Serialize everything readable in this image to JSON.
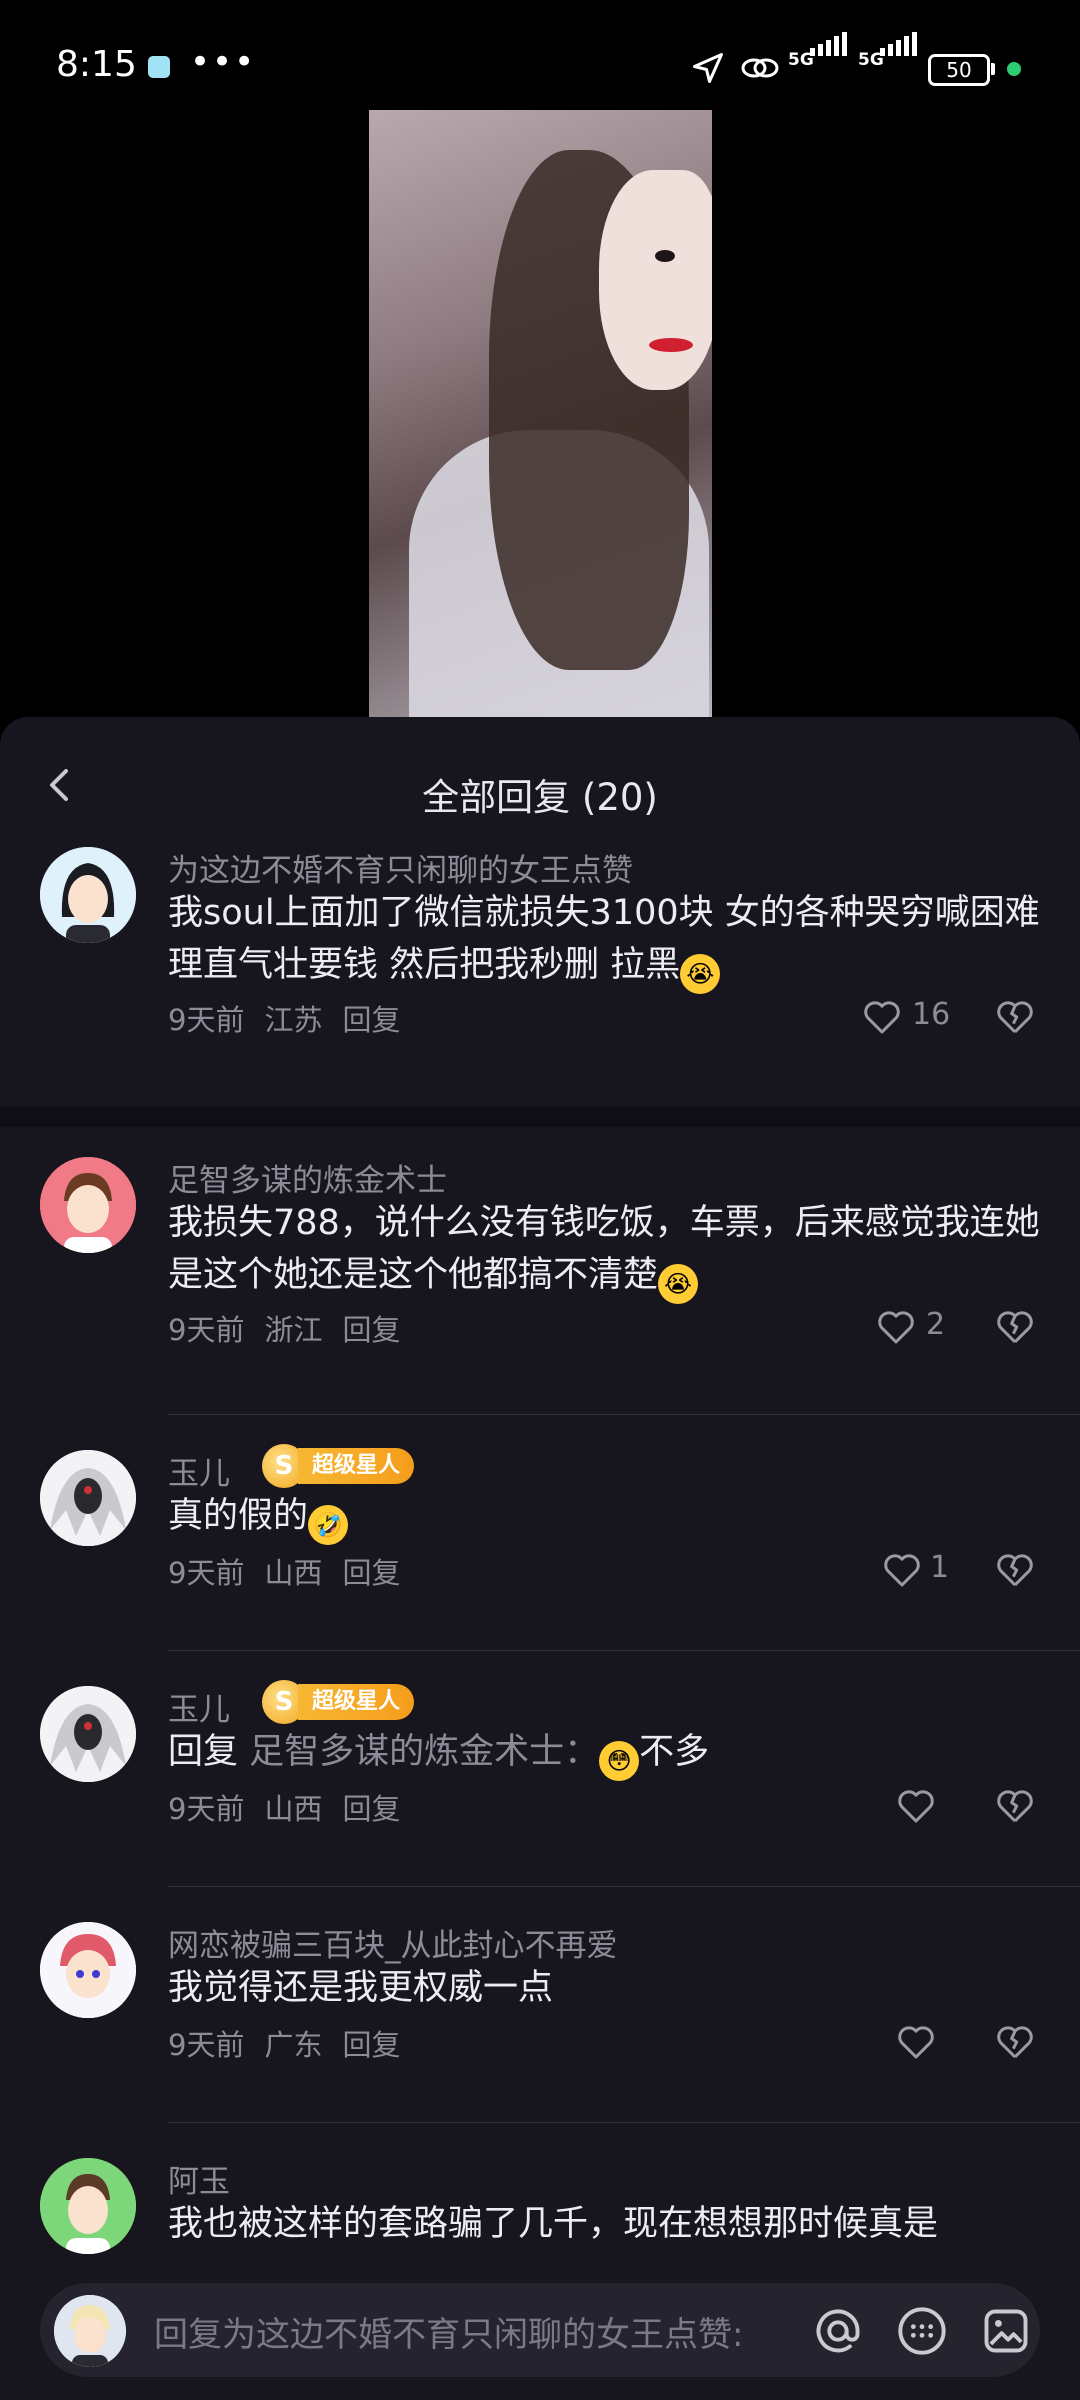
{
  "status_bar": {
    "time": "8:15",
    "network1": "5G",
    "network2": "5G",
    "battery": "50"
  },
  "header": {
    "title": "全部回复 (20)"
  },
  "comments": [
    {
      "name": "为这边不婚不育只闲聊的女王点赞",
      "text": "我soul上面加了微信就损失3100块  女的各种哭穷喊困难 理直气壮要钱  然后把我秒删  拉黑",
      "time": "9天前",
      "region": "江苏",
      "reply": "回复",
      "likes": "16"
    },
    {
      "name": "足智多谋的炼金术士",
      "text": "我损失788，说什么没有钱吃饭，车票，后来感觉我连她是这个她还是这个他都搞不清楚",
      "time": "9天前",
      "region": "浙江",
      "reply": "回复",
      "likes": "2"
    },
    {
      "name": "玉儿",
      "badge": "超级星人",
      "text": "真的假的",
      "time": "9天前",
      "region": "山西",
      "reply": "回复",
      "likes": "1"
    },
    {
      "name": "玉儿",
      "badge": "超级星人",
      "reply_prefix": "回复",
      "reply_to": "足智多谋的炼金术士：",
      "text": "不多",
      "time": "9天前",
      "region": "山西",
      "reply": "回复",
      "likes": ""
    },
    {
      "name": "网恋被骗三百块_从此封心不再爱",
      "text": "我觉得还是我更权威一点",
      "time": "9天前",
      "region": "广东",
      "reply": "回复",
      "likes": ""
    },
    {
      "name": "阿玉",
      "text": "我也被这样的套路骗了几千，现在想想那时候真是"
    }
  ],
  "input": {
    "placeholder": "回复为这边不婚不育只闲聊的女王点赞:"
  },
  "colors": {
    "sheet_bg": "#17161f",
    "text_primary": "#ececf2",
    "text_secondary": "#8c8b97",
    "badge": "#f59d1b"
  }
}
